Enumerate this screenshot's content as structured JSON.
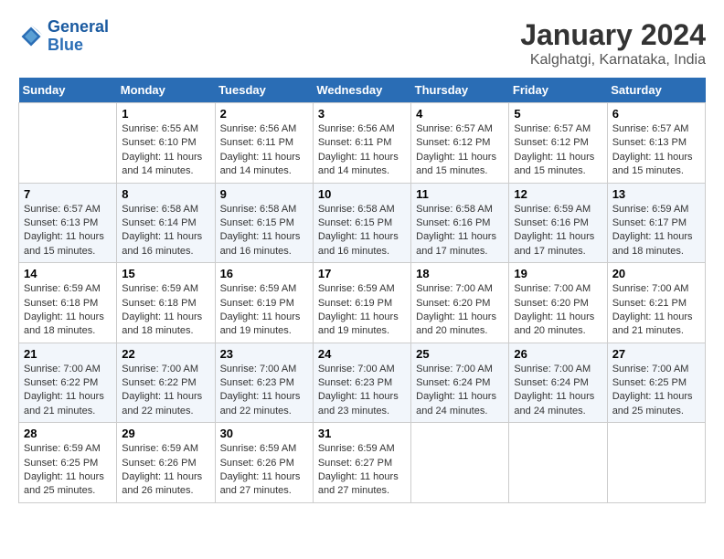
{
  "header": {
    "logo_text_general": "General",
    "logo_text_blue": "Blue",
    "month_year": "January 2024",
    "location": "Kalghatgi, Karnataka, India"
  },
  "calendar": {
    "days_of_week": [
      "Sunday",
      "Monday",
      "Tuesday",
      "Wednesday",
      "Thursday",
      "Friday",
      "Saturday"
    ],
    "weeks": [
      [
        {
          "day": "",
          "sunrise": "",
          "sunset": "",
          "daylight": ""
        },
        {
          "day": "1",
          "sunrise": "Sunrise: 6:55 AM",
          "sunset": "Sunset: 6:10 PM",
          "daylight": "Daylight: 11 hours and 14 minutes."
        },
        {
          "day": "2",
          "sunrise": "Sunrise: 6:56 AM",
          "sunset": "Sunset: 6:11 PM",
          "daylight": "Daylight: 11 hours and 14 minutes."
        },
        {
          "day": "3",
          "sunrise": "Sunrise: 6:56 AM",
          "sunset": "Sunset: 6:11 PM",
          "daylight": "Daylight: 11 hours and 14 minutes."
        },
        {
          "day": "4",
          "sunrise": "Sunrise: 6:57 AM",
          "sunset": "Sunset: 6:12 PM",
          "daylight": "Daylight: 11 hours and 15 minutes."
        },
        {
          "day": "5",
          "sunrise": "Sunrise: 6:57 AM",
          "sunset": "Sunset: 6:12 PM",
          "daylight": "Daylight: 11 hours and 15 minutes."
        },
        {
          "day": "6",
          "sunrise": "Sunrise: 6:57 AM",
          "sunset": "Sunset: 6:13 PM",
          "daylight": "Daylight: 11 hours and 15 minutes."
        }
      ],
      [
        {
          "day": "7",
          "sunrise": "Sunrise: 6:57 AM",
          "sunset": "Sunset: 6:13 PM",
          "daylight": "Daylight: 11 hours and 15 minutes."
        },
        {
          "day": "8",
          "sunrise": "Sunrise: 6:58 AM",
          "sunset": "Sunset: 6:14 PM",
          "daylight": "Daylight: 11 hours and 16 minutes."
        },
        {
          "day": "9",
          "sunrise": "Sunrise: 6:58 AM",
          "sunset": "Sunset: 6:15 PM",
          "daylight": "Daylight: 11 hours and 16 minutes."
        },
        {
          "day": "10",
          "sunrise": "Sunrise: 6:58 AM",
          "sunset": "Sunset: 6:15 PM",
          "daylight": "Daylight: 11 hours and 16 minutes."
        },
        {
          "day": "11",
          "sunrise": "Sunrise: 6:58 AM",
          "sunset": "Sunset: 6:16 PM",
          "daylight": "Daylight: 11 hours and 17 minutes."
        },
        {
          "day": "12",
          "sunrise": "Sunrise: 6:59 AM",
          "sunset": "Sunset: 6:16 PM",
          "daylight": "Daylight: 11 hours and 17 minutes."
        },
        {
          "day": "13",
          "sunrise": "Sunrise: 6:59 AM",
          "sunset": "Sunset: 6:17 PM",
          "daylight": "Daylight: 11 hours and 18 minutes."
        }
      ],
      [
        {
          "day": "14",
          "sunrise": "Sunrise: 6:59 AM",
          "sunset": "Sunset: 6:18 PM",
          "daylight": "Daylight: 11 hours and 18 minutes."
        },
        {
          "day": "15",
          "sunrise": "Sunrise: 6:59 AM",
          "sunset": "Sunset: 6:18 PM",
          "daylight": "Daylight: 11 hours and 18 minutes."
        },
        {
          "day": "16",
          "sunrise": "Sunrise: 6:59 AM",
          "sunset": "Sunset: 6:19 PM",
          "daylight": "Daylight: 11 hours and 19 minutes."
        },
        {
          "day": "17",
          "sunrise": "Sunrise: 6:59 AM",
          "sunset": "Sunset: 6:19 PM",
          "daylight": "Daylight: 11 hours and 19 minutes."
        },
        {
          "day": "18",
          "sunrise": "Sunrise: 7:00 AM",
          "sunset": "Sunset: 6:20 PM",
          "daylight": "Daylight: 11 hours and 20 minutes."
        },
        {
          "day": "19",
          "sunrise": "Sunrise: 7:00 AM",
          "sunset": "Sunset: 6:20 PM",
          "daylight": "Daylight: 11 hours and 20 minutes."
        },
        {
          "day": "20",
          "sunrise": "Sunrise: 7:00 AM",
          "sunset": "Sunset: 6:21 PM",
          "daylight": "Daylight: 11 hours and 21 minutes."
        }
      ],
      [
        {
          "day": "21",
          "sunrise": "Sunrise: 7:00 AM",
          "sunset": "Sunset: 6:22 PM",
          "daylight": "Daylight: 11 hours and 21 minutes."
        },
        {
          "day": "22",
          "sunrise": "Sunrise: 7:00 AM",
          "sunset": "Sunset: 6:22 PM",
          "daylight": "Daylight: 11 hours and 22 minutes."
        },
        {
          "day": "23",
          "sunrise": "Sunrise: 7:00 AM",
          "sunset": "Sunset: 6:23 PM",
          "daylight": "Daylight: 11 hours and 22 minutes."
        },
        {
          "day": "24",
          "sunrise": "Sunrise: 7:00 AM",
          "sunset": "Sunset: 6:23 PM",
          "daylight": "Daylight: 11 hours and 23 minutes."
        },
        {
          "day": "25",
          "sunrise": "Sunrise: 7:00 AM",
          "sunset": "Sunset: 6:24 PM",
          "daylight": "Daylight: 11 hours and 24 minutes."
        },
        {
          "day": "26",
          "sunrise": "Sunrise: 7:00 AM",
          "sunset": "Sunset: 6:24 PM",
          "daylight": "Daylight: 11 hours and 24 minutes."
        },
        {
          "day": "27",
          "sunrise": "Sunrise: 7:00 AM",
          "sunset": "Sunset: 6:25 PM",
          "daylight": "Daylight: 11 hours and 25 minutes."
        }
      ],
      [
        {
          "day": "28",
          "sunrise": "Sunrise: 6:59 AM",
          "sunset": "Sunset: 6:25 PM",
          "daylight": "Daylight: 11 hours and 25 minutes."
        },
        {
          "day": "29",
          "sunrise": "Sunrise: 6:59 AM",
          "sunset": "Sunset: 6:26 PM",
          "daylight": "Daylight: 11 hours and 26 minutes."
        },
        {
          "day": "30",
          "sunrise": "Sunrise: 6:59 AM",
          "sunset": "Sunset: 6:26 PM",
          "daylight": "Daylight: 11 hours and 27 minutes."
        },
        {
          "day": "31",
          "sunrise": "Sunrise: 6:59 AM",
          "sunset": "Sunset: 6:27 PM",
          "daylight": "Daylight: 11 hours and 27 minutes."
        },
        {
          "day": "",
          "sunrise": "",
          "sunset": "",
          "daylight": ""
        },
        {
          "day": "",
          "sunrise": "",
          "sunset": "",
          "daylight": ""
        },
        {
          "day": "",
          "sunrise": "",
          "sunset": "",
          "daylight": ""
        }
      ]
    ]
  }
}
